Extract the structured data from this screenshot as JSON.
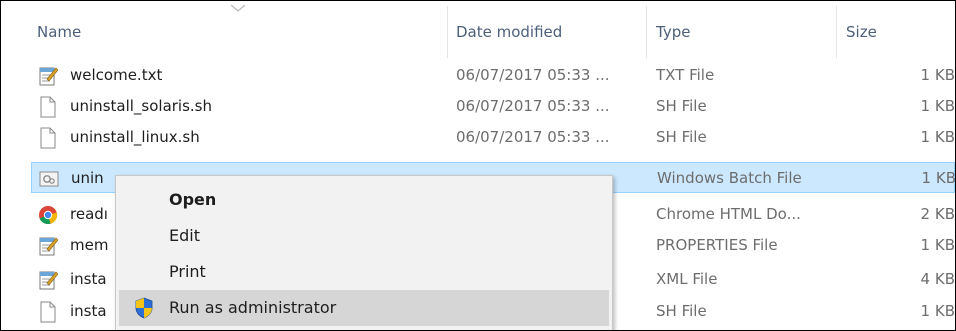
{
  "columns": {
    "name": "Name",
    "date": "Date modified",
    "type": "Type",
    "size": "Size"
  },
  "files": [
    {
      "name": "welcome.txt",
      "date": "06/07/2017 05:33 ...",
      "type": "TXT File",
      "size": "1 KB",
      "icon": "notepad-icon"
    },
    {
      "name": "uninstall_solaris.sh",
      "date": "06/07/2017 05:33 ...",
      "type": "SH File",
      "size": "1 KB",
      "icon": "blank-file-icon"
    },
    {
      "name": "uninstall_linux.sh",
      "date": "06/07/2017 05:33 ...",
      "type": "SH File",
      "size": "1 KB",
      "icon": "blank-file-icon"
    },
    {
      "name": "unin",
      "date": "",
      "type": "Windows Batch File",
      "size": "1 KB",
      "icon": "batch-file-icon",
      "selected": true
    },
    {
      "name": "readı",
      "date": "",
      "type": "Chrome HTML Do...",
      "size": "2 KB",
      "icon": "chrome-icon"
    },
    {
      "name": "mem",
      "date": "",
      "type": "PROPERTIES File",
      "size": "1 KB",
      "icon": "notepad-icon"
    },
    {
      "name": "insta",
      "date": "",
      "type": "XML File",
      "size": "4 KB",
      "icon": "notepad-icon"
    },
    {
      "name": "insta",
      "date": "",
      "type": "SH File",
      "size": "1 KB",
      "icon": "blank-file-icon"
    }
  ],
  "context_menu": {
    "items": [
      {
        "label": "Open",
        "bold": true
      },
      {
        "label": "Edit"
      },
      {
        "label": "Print"
      },
      {
        "label": "Run as administrator",
        "icon": "uac-shield-icon",
        "hovered": true
      }
    ]
  },
  "colors": {
    "selection_bg": "#cce8ff",
    "selection_border": "#99d1ff",
    "menu_bg": "#f2f2f2",
    "menu_hover": "#d6d6d6",
    "header_text": "#4c607a"
  }
}
